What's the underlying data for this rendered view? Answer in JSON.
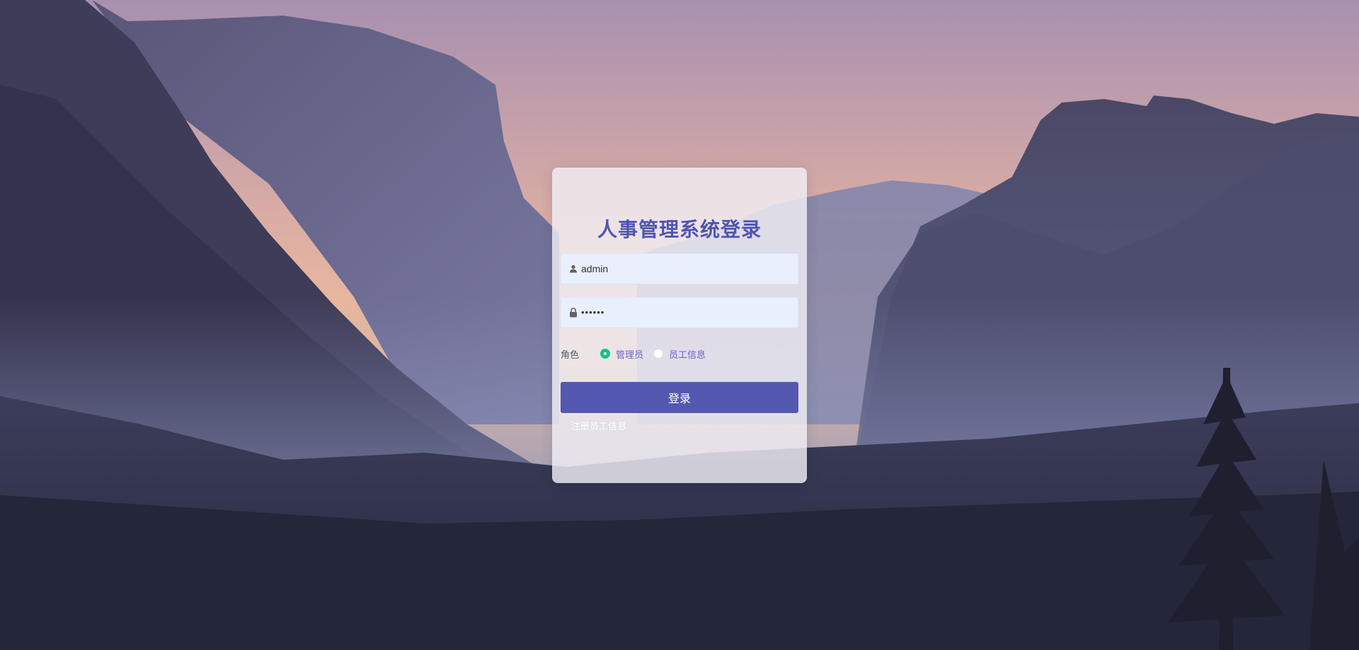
{
  "page": {
    "title": "人事管理系统登录"
  },
  "login_form": {
    "username_value": "admin",
    "password_value": "••••••",
    "role_label": "角色",
    "roles": [
      {
        "label": "管理员",
        "checked": true
      },
      {
        "label": "员工信息",
        "checked": false
      }
    ],
    "submit_label": "登录",
    "register_link": "注册员工信息"
  },
  "colors": {
    "title": "#4f54b0",
    "button": "#5458b0",
    "radio_checked": "#13c28f",
    "input_background": "#e8f0fe"
  },
  "icons": {
    "username": "user-icon",
    "password": "lock-icon"
  }
}
